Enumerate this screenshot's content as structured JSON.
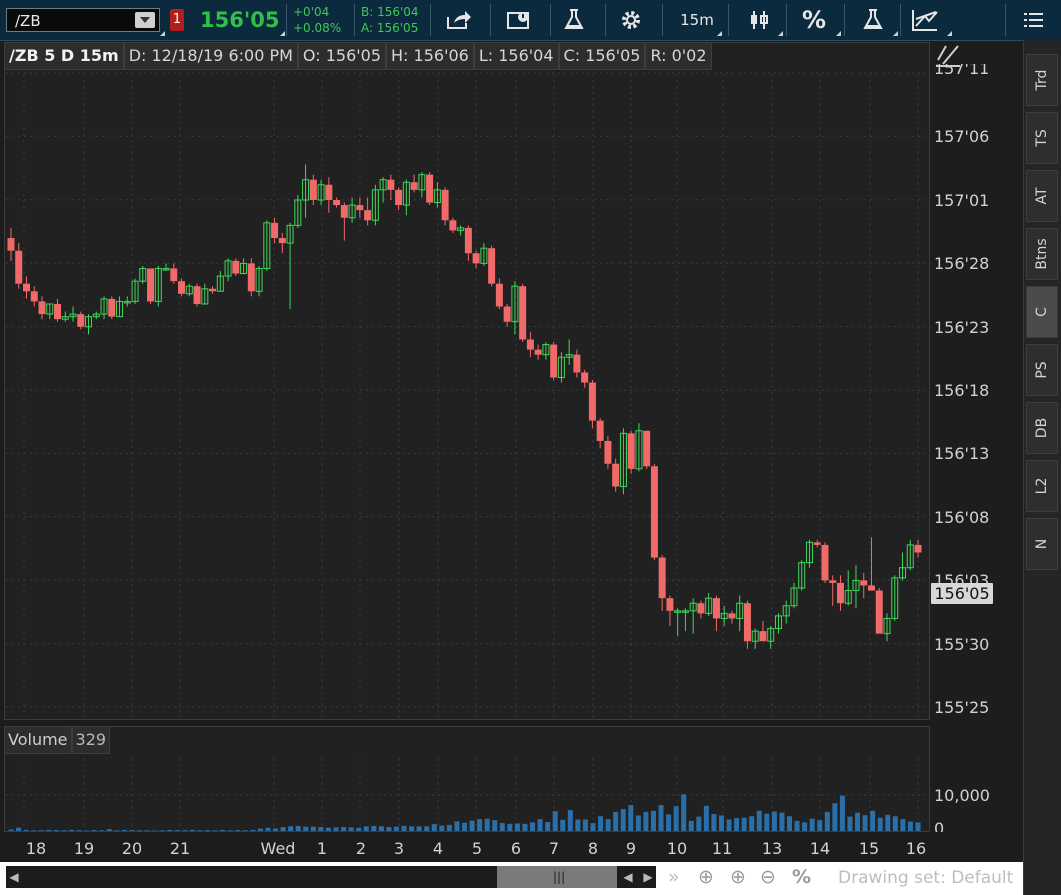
{
  "toolbar": {
    "symbol": "/ZB",
    "alert_count": "1",
    "last_price": "156'05",
    "net_change": "+0'04",
    "pct_change": "+0.08%",
    "bid": "B: 156'04",
    "ask": "A: 156'05",
    "interval": "15m",
    "percent": "%",
    "icons": [
      "share-icon",
      "message-icon",
      "flask-icon",
      "gear-icon",
      "interval",
      "candlestick-icon",
      "percent-icon",
      "studies-flask-icon",
      "drawing-tools-icon",
      "menu-icon"
    ]
  },
  "header": {
    "title": "/ZB 5 D 15m",
    "date": "D: 12/18/19 6:00 PM",
    "open": "O: 156'05",
    "high": "H: 156'06",
    "low": "L: 156'04",
    "close": "C: 156'05",
    "range": "R: 0'02"
  },
  "right_tabs": [
    "Trd",
    "TS",
    "AT",
    "Btns",
    "C",
    "PS",
    "DB",
    "L2",
    "N"
  ],
  "active_tab": "C",
  "price_axis": {
    "labels": [
      "157'11",
      "157'06",
      "157'01",
      "156'28",
      "156'23",
      "156'18",
      "156'13",
      "156'08",
      "156'03",
      "155'30",
      "155'25"
    ],
    "current": "156'05"
  },
  "volume": {
    "label": "Volume",
    "value": "329",
    "axis_labels": [
      "10,000",
      "0"
    ]
  },
  "time_axis": [
    "18",
    "19",
    "20",
    "21",
    "Wed",
    "1",
    "2",
    "3",
    "4",
    "5",
    "6",
    "7",
    "8",
    "9",
    "10",
    "11",
    "13",
    "14",
    "15",
    "16"
  ],
  "bottom": {
    "drawing_set": "Drawing set: Default",
    "percent_icon": "%"
  },
  "colors": {
    "up": "#3ed85a",
    "down": "#f06a6a",
    "volume": "#2b6fa8",
    "price_tag": "#d8d8d8"
  },
  "chart_data": {
    "type": "candlestick",
    "title": "/ZB 5 D 15m",
    "ylim": [
      "155'25",
      "157'11"
    ],
    "note": "approximate OHLC in 32nds above 155'00 read from gridlines",
    "candles": [
      [
        30.0,
        30.8,
        28.2,
        29.0
      ],
      [
        29.0,
        29.6,
        26.0,
        26.4
      ],
      [
        26.4,
        27.0,
        25.2,
        25.8
      ],
      [
        25.8,
        26.2,
        24.6,
        25.0
      ],
      [
        25.0,
        25.4,
        23.6,
        24.0
      ],
      [
        24.0,
        24.8,
        23.6,
        24.8
      ],
      [
        24.8,
        25.2,
        23.4,
        23.6
      ],
      [
        23.6,
        24.2,
        23.4,
        23.8
      ],
      [
        23.8,
        24.6,
        23.4,
        24.0
      ],
      [
        24.0,
        24.2,
        22.8,
        23.0
      ],
      [
        23.0,
        24.0,
        22.4,
        23.8
      ],
      [
        23.8,
        24.2,
        23.6,
        24.0
      ],
      [
        24.0,
        25.4,
        23.6,
        25.2
      ],
      [
        25.2,
        25.4,
        23.6,
        23.8
      ],
      [
        23.8,
        25.4,
        23.8,
        25.0
      ],
      [
        25.0,
        25.4,
        24.6,
        25.0
      ],
      [
        25.0,
        26.8,
        24.8,
        26.6
      ],
      [
        26.6,
        27.8,
        26.4,
        27.6
      ],
      [
        27.6,
        27.6,
        24.8,
        25.0
      ],
      [
        25.0,
        27.8,
        24.6,
        27.6
      ],
      [
        27.6,
        28.0,
        27.4,
        27.6
      ],
      [
        27.6,
        28.0,
        26.4,
        26.6
      ],
      [
        26.6,
        26.8,
        25.4,
        25.6
      ],
      [
        25.6,
        26.4,
        25.4,
        26.2
      ],
      [
        26.2,
        26.4,
        24.6,
        24.8
      ],
      [
        24.8,
        26.4,
        24.8,
        26.0
      ],
      [
        26.0,
        26.2,
        25.6,
        25.8
      ],
      [
        25.8,
        27.4,
        25.8,
        27.0
      ],
      [
        27.0,
        28.4,
        26.6,
        28.2
      ],
      [
        28.2,
        28.4,
        27.0,
        27.2
      ],
      [
        27.2,
        28.4,
        27.2,
        28.0
      ],
      [
        28.0,
        28.4,
        25.4,
        25.8
      ],
      [
        25.8,
        27.8,
        25.4,
        27.6
      ],
      [
        27.6,
        31.4,
        27.4,
        31.2
      ],
      [
        31.2,
        31.6,
        29.6,
        30.0
      ],
      [
        30.0,
        30.4,
        28.8,
        29.6
      ],
      [
        29.6,
        31.2,
        24.4,
        31.0
      ],
      [
        31.0,
        33.4,
        30.8,
        33.0
      ],
      [
        33.0,
        35.8,
        31.6,
        34.6
      ],
      [
        34.6,
        35.0,
        32.6,
        33.0
      ],
      [
        33.0,
        34.6,
        32.6,
        34.2
      ],
      [
        34.2,
        34.8,
        32.0,
        33.0
      ],
      [
        33.0,
        33.2,
        32.4,
        32.6
      ],
      [
        32.6,
        32.8,
        29.8,
        31.6
      ],
      [
        31.6,
        33.2,
        31.2,
        32.6
      ],
      [
        32.6,
        33.2,
        31.6,
        32.2
      ],
      [
        32.2,
        33.2,
        31.0,
        31.4
      ],
      [
        31.4,
        34.2,
        31.0,
        33.8
      ],
      [
        33.8,
        34.8,
        32.8,
        34.6
      ],
      [
        34.6,
        35.0,
        33.0,
        33.8
      ],
      [
        33.8,
        34.0,
        32.2,
        32.6
      ],
      [
        32.6,
        34.6,
        31.8,
        34.4
      ],
      [
        34.4,
        35.0,
        33.6,
        33.8
      ],
      [
        33.8,
        35.2,
        33.2,
        35.0
      ],
      [
        35.0,
        35.2,
        32.6,
        32.8
      ],
      [
        32.8,
        34.4,
        32.4,
        33.8
      ],
      [
        33.8,
        34.0,
        31.0,
        31.4
      ],
      [
        31.4,
        31.6,
        30.4,
        30.6
      ],
      [
        30.6,
        31.0,
        30.2,
        30.8
      ],
      [
        30.8,
        31.0,
        28.2,
        28.8
      ],
      [
        28.8,
        29.0,
        27.6,
        28.0
      ],
      [
        28.0,
        29.6,
        27.8,
        29.2
      ],
      [
        29.2,
        29.4,
        26.2,
        26.4
      ],
      [
        26.4,
        26.8,
        24.4,
        24.6
      ],
      [
        24.6,
        24.8,
        23.0,
        23.4
      ],
      [
        23.4,
        26.6,
        22.4,
        26.2
      ],
      [
        26.2,
        26.4,
        21.8,
        22.0
      ],
      [
        22.0,
        22.6,
        20.6,
        21.2
      ],
      [
        21.2,
        21.6,
        20.4,
        20.8
      ],
      [
        20.8,
        21.8,
        20.4,
        21.6
      ],
      [
        21.6,
        21.8,
        18.8,
        19.0
      ],
      [
        19.0,
        21.0,
        18.6,
        20.6
      ],
      [
        20.6,
        22.0,
        20.0,
        20.8
      ],
      [
        20.8,
        21.2,
        19.0,
        19.4
      ],
      [
        19.4,
        19.6,
        18.2,
        18.6
      ],
      [
        18.6,
        18.8,
        15.0,
        15.6
      ],
      [
        15.6,
        15.8,
        13.4,
        14.0
      ],
      [
        14.0,
        14.4,
        11.8,
        12.2
      ],
      [
        12.2,
        12.6,
        10.0,
        10.4
      ],
      [
        10.4,
        15.0,
        9.8,
        14.6
      ],
      [
        14.6,
        14.8,
        11.4,
        11.8
      ],
      [
        11.8,
        15.4,
        11.6,
        14.8
      ],
      [
        14.8,
        14.8,
        11.8,
        12.0
      ],
      [
        12.0,
        12.2,
        4.6,
        4.8
      ],
      [
        4.8,
        5.0,
        0.6,
        1.6
      ],
      [
        1.6,
        1.8,
        -0.6,
        0.6
      ],
      [
        0.6,
        0.8,
        -1.4,
        0.6
      ],
      [
        0.6,
        0.8,
        -1.0,
        0.6
      ],
      [
        0.6,
        1.6,
        -1.2,
        1.2
      ],
      [
        1.2,
        1.4,
        0.0,
        0.4
      ],
      [
        0.4,
        2.0,
        0.2,
        1.6
      ],
      [
        1.6,
        1.8,
        -1.0,
        0.0
      ],
      [
        0.0,
        1.0,
        -0.6,
        0.4
      ],
      [
        0.4,
        0.6,
        -0.4,
        0.0
      ],
      [
        0.0,
        1.8,
        -1.0,
        1.2
      ],
      [
        1.2,
        1.4,
        -2.4,
        -1.8
      ],
      [
        -1.8,
        -0.8,
        -2.4,
        -1.0
      ],
      [
        -1.0,
        -0.2,
        -1.4,
        -1.8
      ],
      [
        -1.8,
        -0.6,
        -2.4,
        -0.8
      ],
      [
        -0.8,
        0.4,
        -1.2,
        0.2
      ],
      [
        0.2,
        1.4,
        -0.4,
        1.0
      ],
      [
        1.0,
        2.8,
        0.8,
        2.4
      ],
      [
        2.4,
        4.6,
        2.2,
        4.4
      ],
      [
        4.4,
        6.2,
        4.0,
        6.0
      ],
      [
        6.0,
        6.2,
        5.6,
        5.8
      ],
      [
        5.8,
        6.0,
        2.8,
        3.0
      ],
      [
        3.0,
        3.4,
        1.0,
        2.8
      ],
      [
        2.8,
        3.4,
        0.6,
        1.2
      ],
      [
        1.2,
        3.8,
        1.0,
        2.2
      ],
      [
        2.2,
        4.2,
        0.8,
        3.0
      ],
      [
        3.0,
        3.6,
        1.6,
        2.6
      ],
      [
        2.6,
        6.4,
        2.2,
        2.2
      ],
      [
        2.2,
        2.4,
        0.6,
        -1.2
      ],
      [
        -1.2,
        0.4,
        -1.8,
        0.0
      ],
      [
        0.0,
        3.4,
        -0.2,
        3.2
      ],
      [
        3.2,
        5.2,
        3.0,
        4.0
      ],
      [
        4.0,
        6.2,
        3.8,
        5.8
      ],
      [
        5.8,
        6.2,
        4.8,
        5.2
      ]
    ],
    "volume_values": [
      400,
      900,
      300,
      200,
      200,
      300,
      250,
      200,
      300,
      200,
      150,
      250,
      200,
      500,
      200,
      300,
      250,
      200,
      200,
      150,
      200,
      300,
      250,
      200,
      300,
      200,
      250,
      200,
      300,
      200,
      250,
      200,
      300,
      700,
      900,
      700,
      1100,
      1300,
      1400,
      1200,
      1200,
      1100,
      900,
      1000,
      1100,
      1000,
      900,
      1300,
      1400,
      1300,
      1100,
      1200,
      1400,
      1300,
      1300,
      1300,
      1900,
      1500,
      1700,
      2700,
      2300,
      2900,
      3300,
      3400,
      3000,
      2200,
      2000,
      2100,
      2000,
      2400,
      3300,
      2500,
      5500,
      3100,
      5800,
      3200,
      3200,
      2200,
      4100,
      3300,
      5300,
      6100,
      7200,
      4300,
      5300,
      5600,
      7200,
      4600,
      6900,
      10200,
      2800,
      4000,
      7000,
      4700,
      4300,
      3200,
      3600,
      3700,
      4100,
      5600,
      4800,
      5400,
      5100,
      4100,
      2800,
      2400,
      3400,
      3000,
      5300,
      7700,
      9800,
      4000,
      5100,
      4400,
      5600,
      3700,
      4500,
      4100,
      3300,
      2600,
      2400
    ]
  }
}
